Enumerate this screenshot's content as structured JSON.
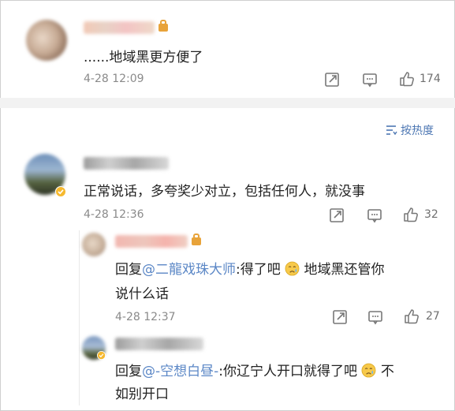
{
  "comments": [
    {
      "text": "......地域黑更方便了",
      "time": "4-28 12:09",
      "likes": "174"
    },
    {
      "text": "正常说话，多夸奖少对立，包括任何人，就没事",
      "time": "4-28 12:36",
      "likes": "32"
    }
  ],
  "sort": {
    "label": "按热度"
  },
  "replies": [
    {
      "prefix": "回复",
      "mention": "@二龍戏珠大师",
      "text1": ":得了吧",
      "text2": "地域黑还管你",
      "text3": "说什么话",
      "time": "4-28 12:37",
      "likes": "27"
    },
    {
      "prefix": "回复",
      "mention": "@-空想白昼-",
      "text1": ":你辽宁人开口就得了吧",
      "text2": "不",
      "text3": "如别开口"
    }
  ],
  "colors": {
    "link": "#5b87c6",
    "meta": "#8a8a8a",
    "divider": "#f2f2f2"
  },
  "icons": [
    "vip-badge-icon",
    "share-icon",
    "comment-icon",
    "like-icon",
    "sort-icon",
    "sad-emoji-icon",
    "verified-badge-icon"
  ]
}
